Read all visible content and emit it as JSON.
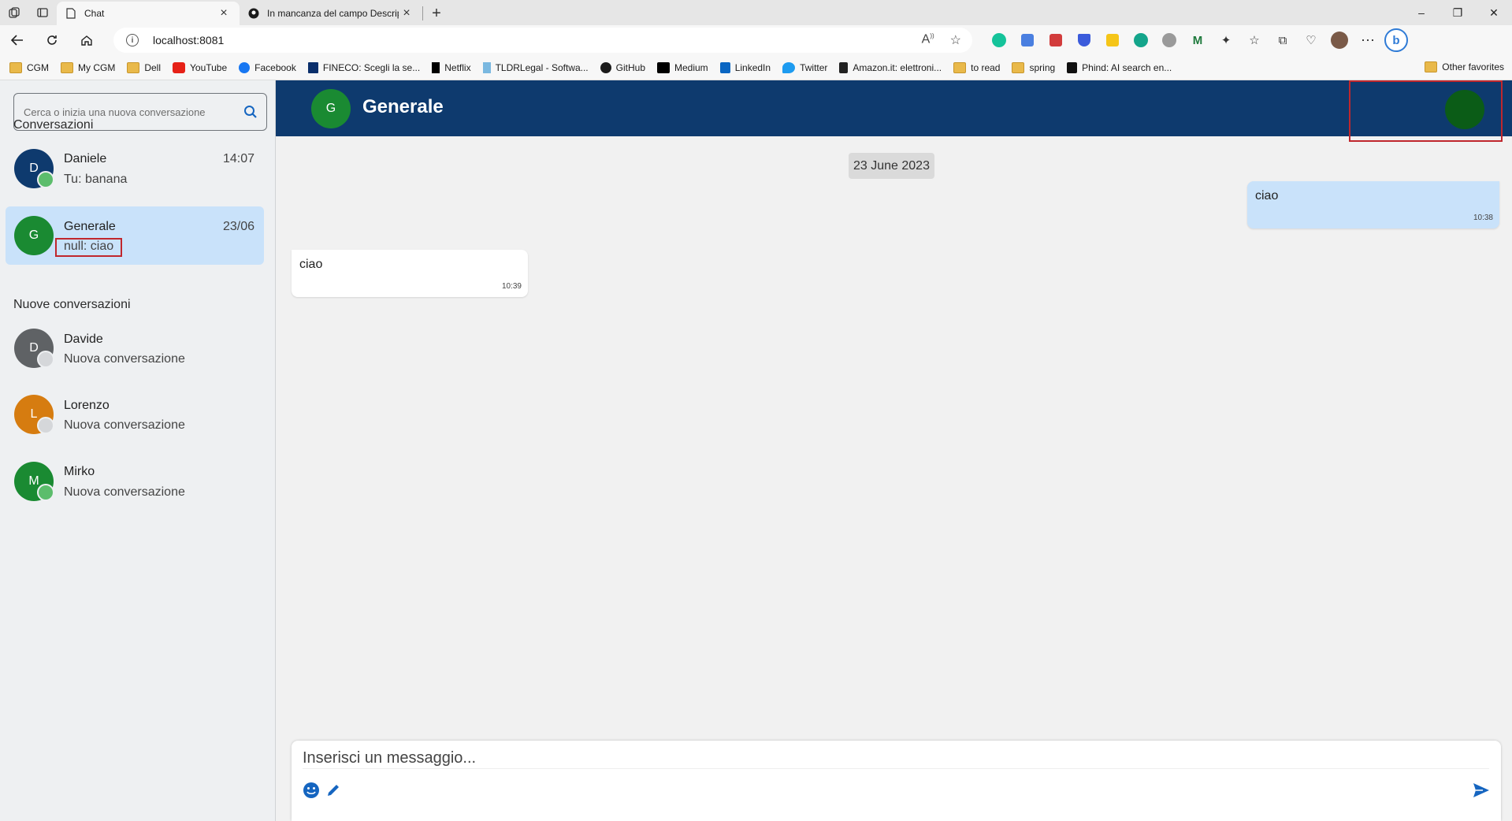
{
  "browser": {
    "tabs": [
      {
        "title": "Chat",
        "active": true
      },
      {
        "title": "In mancanza del campo Descript",
        "active": false
      }
    ],
    "url": "localhost:8081",
    "favorites": [
      {
        "label": "CGM",
        "icon": "folder-icon"
      },
      {
        "label": "My CGM",
        "icon": "folder-icon"
      },
      {
        "label": "Dell",
        "icon": "folder-icon"
      },
      {
        "label": "YouTube",
        "icon": "youtube-icon"
      },
      {
        "label": "Facebook",
        "icon": "facebook-icon"
      },
      {
        "label": "FINECO: Scegli la se...",
        "icon": "fineco-icon"
      },
      {
        "label": "Netflix",
        "icon": "netflix-icon"
      },
      {
        "label": "TLDRLegal - Softwa...",
        "icon": "tldr-icon"
      },
      {
        "label": "GitHub",
        "icon": "github-icon"
      },
      {
        "label": "Medium",
        "icon": "medium-icon"
      },
      {
        "label": "LinkedIn",
        "icon": "linkedin-icon"
      },
      {
        "label": "Twitter",
        "icon": "twitter-icon"
      },
      {
        "label": "Amazon.it: elettroni...",
        "icon": "amazon-icon"
      },
      {
        "label": "to read",
        "icon": "folder-icon"
      },
      {
        "label": "spring",
        "icon": "folder-icon"
      },
      {
        "label": "Phind: AI search en...",
        "icon": "phind-icon"
      }
    ],
    "other_favorites": "Other favorites"
  },
  "sidebar": {
    "search_placeholder": "Cerca o inizia una nuova conversazione",
    "conversations_title": "Conversazioni",
    "new_conversations_title": "Nuove conversazioni",
    "conversations": [
      {
        "initial": "D",
        "name": "Daniele",
        "preview": "Tu: banana",
        "time": "14:07",
        "avatar_color": "#0e3a6e",
        "status_color": "#5cbd6c",
        "selected": false
      },
      {
        "initial": "G",
        "name": "Generale",
        "preview": "null: ciao",
        "time": "23/06",
        "avatar_color": "#1a8a32",
        "status_color": "",
        "selected": true
      }
    ],
    "new_conversations": [
      {
        "initial": "D",
        "name": "Davide",
        "preview": "Nuova conversazione",
        "avatar_color": "#5f6265",
        "status_color": "#d5d7da"
      },
      {
        "initial": "L",
        "name": "Lorenzo",
        "preview": "Nuova conversazione",
        "avatar_color": "#d67c10",
        "status_color": "#d5d7da"
      },
      {
        "initial": "M",
        "name": "Mirko",
        "preview": "Nuova conversazione",
        "avatar_color": "#1a8a32",
        "status_color": "#5cbd6c"
      }
    ]
  },
  "chat": {
    "header_initial": "G",
    "header_title": "Generale",
    "date_chip": "23 June 2023",
    "messages": [
      {
        "direction": "out",
        "text": "ciao",
        "time": "10:38"
      },
      {
        "direction": "in",
        "text": "ciao",
        "time": "10:39"
      }
    ],
    "composer_placeholder": "Inserisci un messaggio..."
  }
}
